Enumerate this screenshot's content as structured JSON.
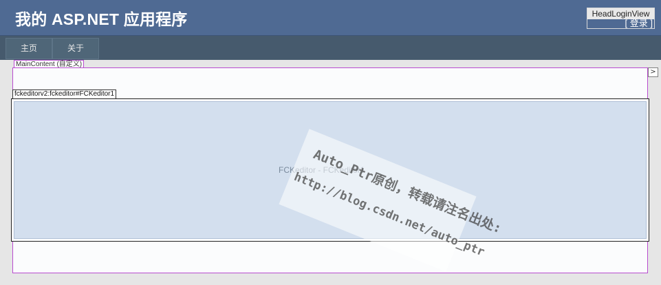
{
  "header": {
    "title": "我的 ASP.NET 应用程序",
    "login_view_tag": "HeadLoginView",
    "login_link": "[ 登录 ]"
  },
  "nav": {
    "items": [
      {
        "label": "主页"
      },
      {
        "label": "关于"
      }
    ]
  },
  "content": {
    "placeholder_tag": "MainContent (自定义)",
    "expand_glyph": ">"
  },
  "editor": {
    "control_tag": "fckeditorv2:fckeditor#FCKeditor1",
    "display_label": "FCKeditor - FCKeditor1"
  },
  "watermark": {
    "line1": "Auto_Ptr原创，转载请注名出处:",
    "line2": "http://blog.csdn.net/auto_ptr"
  },
  "colors": {
    "header_bg": "#4f6a93",
    "nav_bg": "#465a6d",
    "content_border": "#b84bcf",
    "editor_bg": "#d3dfee"
  }
}
